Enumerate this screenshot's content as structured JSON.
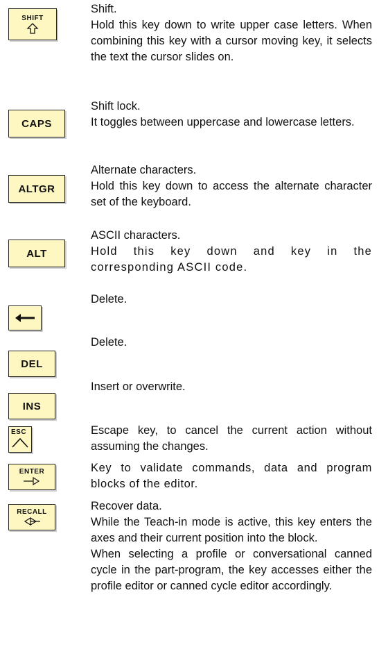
{
  "keys": [
    {
      "id": "shift",
      "key_label": "SHIFT",
      "icon": "up-outline-arrow-icon",
      "title": "Shift.",
      "text": "Hold this key down to write upper case letters. When combining this key with a cursor moving key, it selects the text the cursor slides on."
    },
    {
      "id": "caps",
      "key_label": "CAPS",
      "title": "Shift lock.",
      "text": "It toggles between uppercase and lowercase letters."
    },
    {
      "id": "altgr",
      "key_label": "ALTGR",
      "title": "Alternate characters.",
      "text": "Hold this key down to access the alternate character set of the keyboard."
    },
    {
      "id": "alt",
      "key_label": "ALT",
      "title": "ASCII characters.",
      "text": "Hold this key down and key in the corresponding ASCII code."
    },
    {
      "id": "backspace",
      "icon": "left-arrow-icon",
      "title": "Delete."
    },
    {
      "id": "del",
      "key_label": "DEL",
      "title": "Delete."
    },
    {
      "id": "ins",
      "key_label": "INS",
      "title": "Insert or overwrite."
    },
    {
      "id": "esc",
      "key_label": "ESC",
      "icon": "caret-up-icon",
      "title": "Escape key, to cancel the current action without assuming the changes."
    },
    {
      "id": "enter",
      "key_label": "ENTER",
      "icon": "right-outline-arrow-icon",
      "title": "Key to validate commands, data and program blocks of the editor."
    },
    {
      "id": "recall",
      "key_label": "RECALL",
      "icon": "left-outline-arrow-icon",
      "title": "Recover data.",
      "text": "While the Teach-in mode is active, this key enters the axes and their current position into the block.",
      "text2": "When selecting a profile or conversational canned cycle in the part-program, the key accesses either the profile editor or canned cycle editor accordingly."
    }
  ],
  "colors": {
    "key_fill": "#fff7c2",
    "key_border": "#222222"
  }
}
